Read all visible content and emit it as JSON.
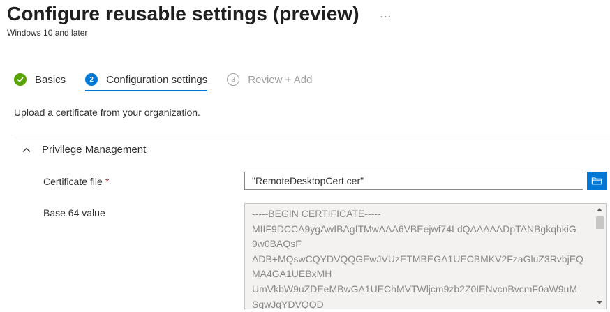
{
  "page": {
    "title": "Configure reusable settings (preview)",
    "more_label": "...",
    "subtitle": "Windows 10 and later"
  },
  "wizard": {
    "steps": [
      {
        "number": "",
        "label": "Basics",
        "state": "done"
      },
      {
        "number": "2",
        "label": "Configuration settings",
        "state": "active"
      },
      {
        "number": "3",
        "label": "Review + Add",
        "state": "pending"
      }
    ]
  },
  "intro": "Upload a certificate from your organization.",
  "section": {
    "title": "Privilege Management",
    "expanded": true
  },
  "fields": {
    "certificate": {
      "label": "Certificate file",
      "required_marker": "*",
      "value": "\"RemoteDesktopCert.cer\""
    },
    "base64": {
      "label": "Base 64 value",
      "lines": [
        "-----BEGIN CERTIFICATE-----",
        "MIIF9DCCA9ygAwIBAgITMwAAA6VBEejwf74LdQAAAAADpTANBgkqhkiG",
        "9w0BAQsF",
        "ADB+MQswCQYDVQQGEwJVUzETMBEGA1UECBMKV2FzaGluZ3RvbjEQ",
        "MA4GA1UEBxMH",
        "UmVkbW9uZDEeMBwGA1UEChMVTWljcm9zb2Z0IENvcnBvcmF0aW9uM",
        "SgwJgYDVQQD"
      ]
    }
  },
  "colors": {
    "accent": "#0078d4",
    "success": "#57a300",
    "required": "#a4262c"
  },
  "icons": {
    "done_step": "checkmark-icon",
    "section_toggle": "chevron-up-icon",
    "browse": "folder-icon"
  }
}
